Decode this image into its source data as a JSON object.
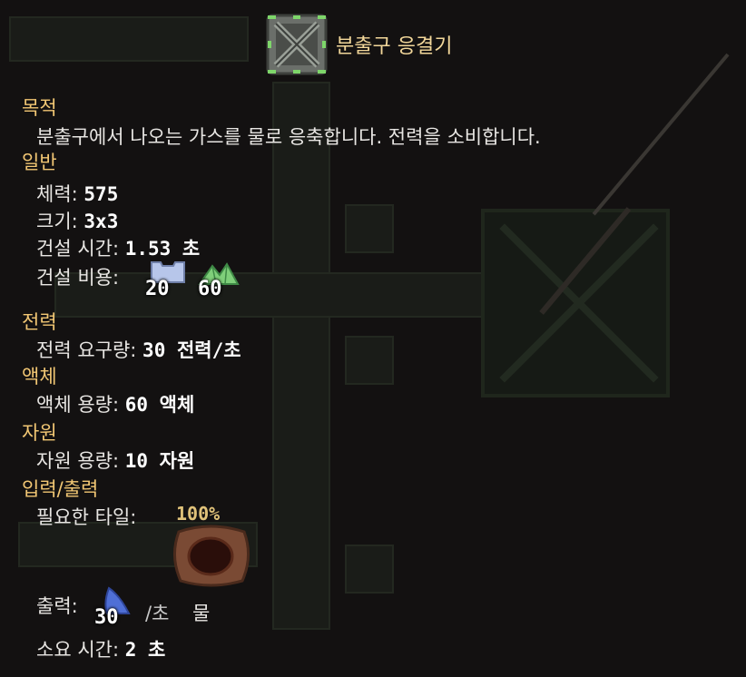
{
  "title": "분출구 응결기",
  "sections": {
    "purpose": {
      "header": "목적",
      "text": "분출구에서 나오는 가스를 물로 응축합니다. 전력을 소비합니다."
    },
    "general": {
      "header": "일반",
      "health_label": "체력:",
      "health_value": "575",
      "size_label": "크기:",
      "size_value": "3x3",
      "build_time_label": "건설 시간:",
      "build_time_value": "1.53 초",
      "build_cost_label": "건설 비용:",
      "cost": [
        {
          "icon": "metal-plate-icon",
          "amount": "20"
        },
        {
          "icon": "green-crystal-icon",
          "amount": "60"
        }
      ]
    },
    "power": {
      "header": "전력",
      "label": "전력 요구량:",
      "value": "30 전력/초"
    },
    "liquid": {
      "header": "액체",
      "label": "액체 용량:",
      "value": "60 액체"
    },
    "resource": {
      "header": "자원",
      "label": "자원 용량:",
      "value": "10 자원"
    },
    "io": {
      "header": "입력/출력",
      "tile_label": "필요한 타일:",
      "tile_percent": "100%",
      "output_label": "출력:",
      "output_amount": "30",
      "output_rate": "/초",
      "output_item": "물",
      "time_label": "소요 시간:",
      "time_value": "2 초"
    }
  },
  "colors": {
    "header": "#f2c774",
    "title": "#f2d79a",
    "text": "#e8e6e3",
    "background": "#131111"
  }
}
